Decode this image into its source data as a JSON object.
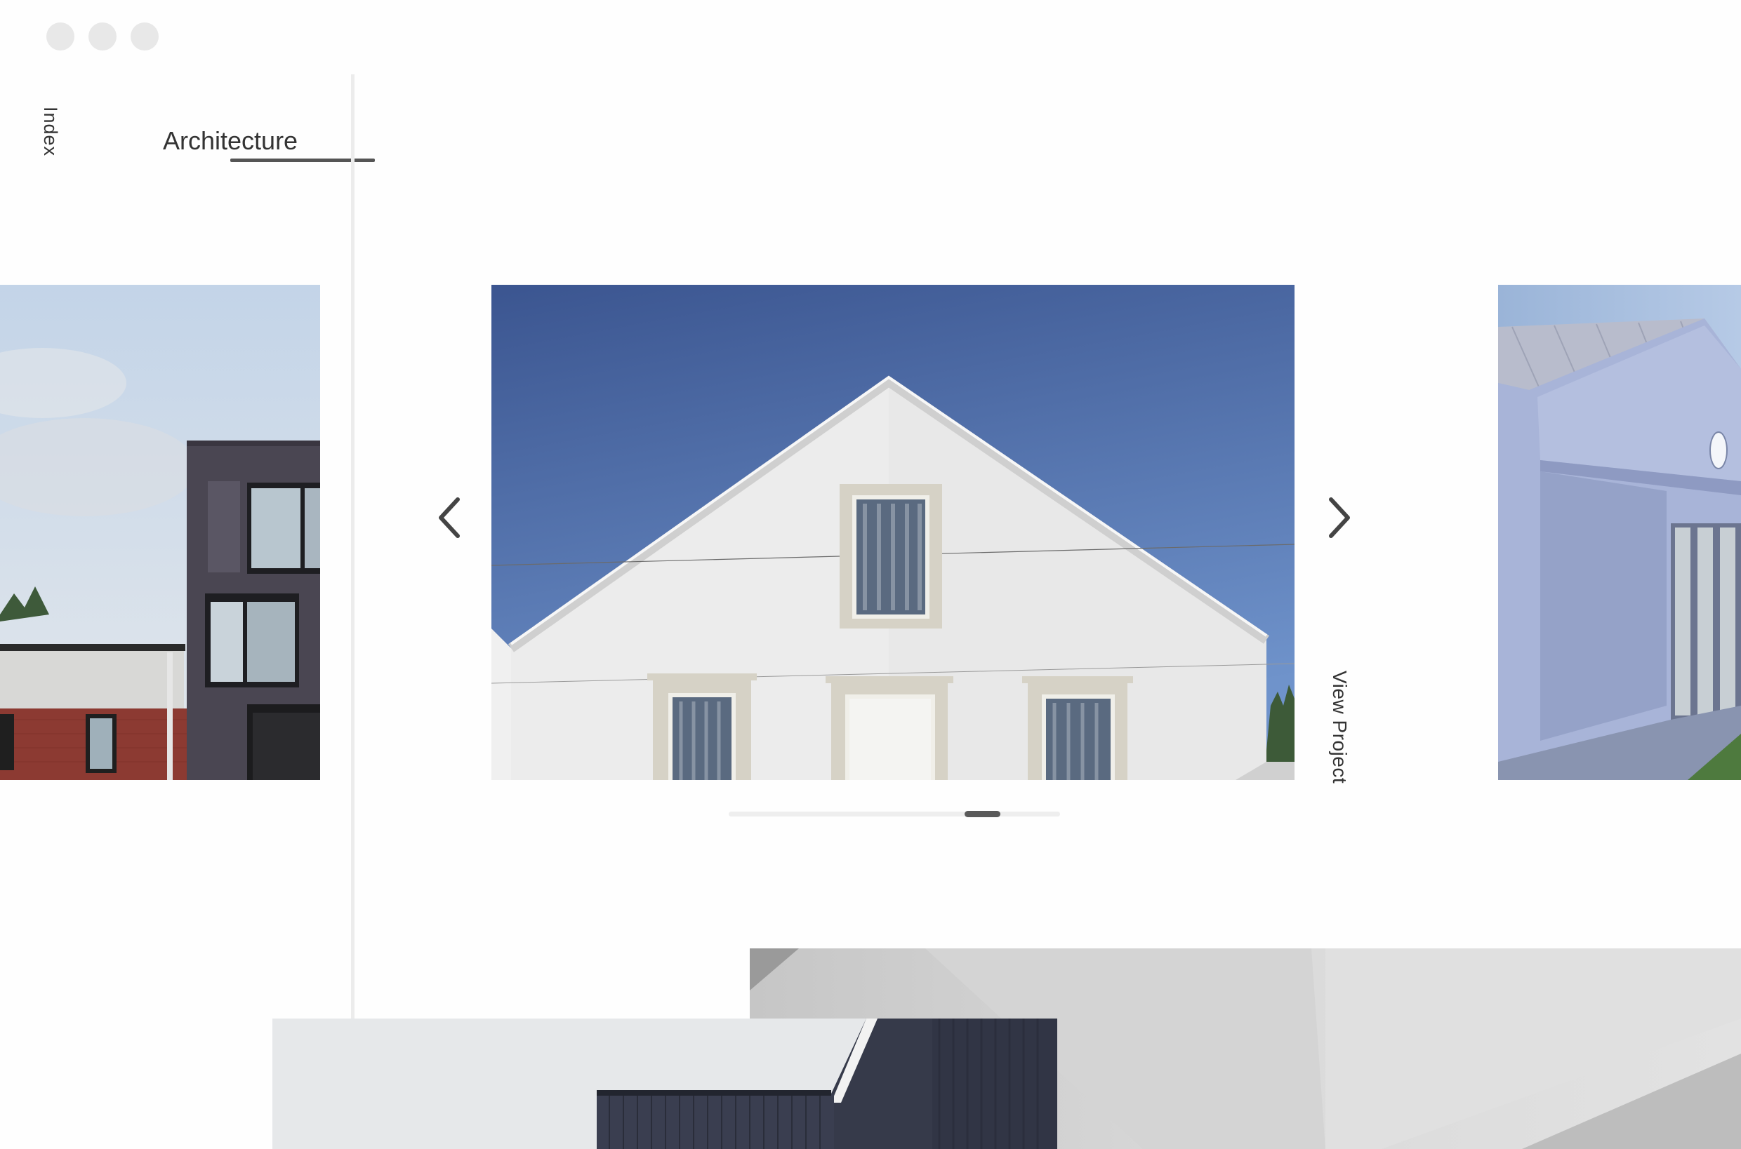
{
  "nav": {
    "index_label": "Index",
    "category_label": "Architecture"
  },
  "carousel": {
    "prev_icon": "chevron-left-icon",
    "next_icon": "chevron-right-icon",
    "view_project_label": "View Project",
    "scroll_position": 0.76
  },
  "colors": {
    "text": "#333333",
    "accent_bar": "#555555",
    "window_dot": "#e8e8e8"
  }
}
